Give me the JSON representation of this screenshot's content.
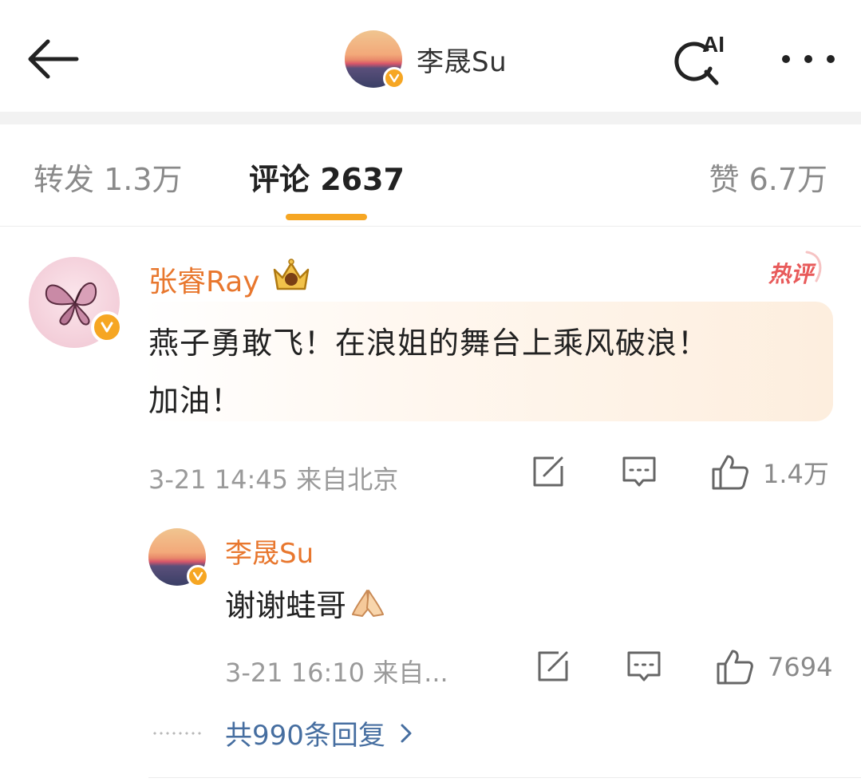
{
  "header": {
    "title": "李晟Su",
    "ai_label": "AI",
    "back_icon": "arrow-left-icon",
    "more_icon": "more-horizontal-icon"
  },
  "tabs": {
    "repost": "转发 1.3万",
    "comment": "评论 2637",
    "like": "赞 6.7万",
    "active": "comment"
  },
  "comment": {
    "author": "张睿Ray",
    "hot_badge": "热评",
    "text_line1": "燕子勇敢飞！在浪姐的舞台上乘风破浪！",
    "text_line2": "加油！",
    "meta": "3-21 14:45 来自北京",
    "likes": "1.4万"
  },
  "reply": {
    "author": "李晟Su",
    "text": "谢谢蛙哥",
    "meta": "3-21 16:10 来自...",
    "likes": "7694"
  },
  "more_replies": "共990条回复",
  "colors": {
    "accent": "#f6a623",
    "name_orange": "#e8772e",
    "link_blue": "#466ea0",
    "hot_red": "#e85a5a"
  }
}
